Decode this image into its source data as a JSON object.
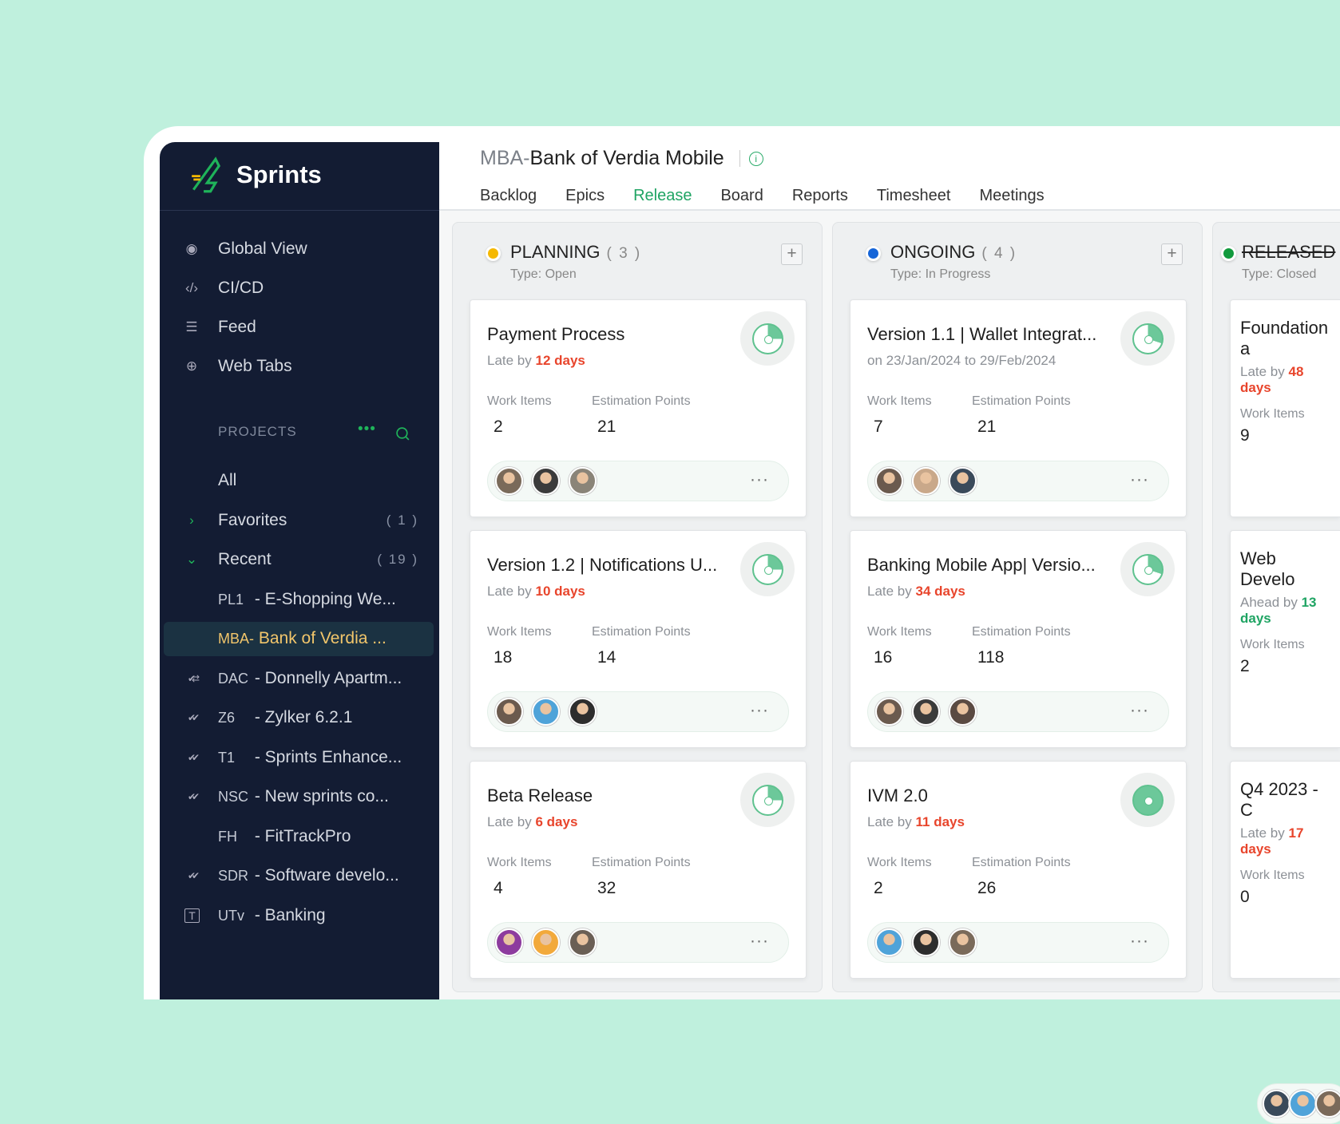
{
  "brand": {
    "name": "Sprints"
  },
  "sidebar": {
    "nav": [
      {
        "label": "Global View",
        "icon": "eye-icon"
      },
      {
        "label": "CI/CD",
        "icon": "code-icon"
      },
      {
        "label": "Feed",
        "icon": "feed-icon"
      },
      {
        "label": "Web Tabs",
        "icon": "globe-icon"
      }
    ],
    "projects_heading": "PROJECTS",
    "all": "All",
    "favorites": {
      "label": "Favorites",
      "count": "( 1 )"
    },
    "recent": {
      "label": "Recent",
      "count": "( 19 )"
    },
    "projects": [
      {
        "code": "PL1",
        "name": "- E-Shopping We...",
        "icon": ""
      },
      {
        "code": "MBA-",
        "name": "Bank of Verdia ...",
        "icon": "",
        "active": true
      },
      {
        "code": "DAC",
        "name": "- Donnelly Apartm...",
        "icon": "check-sync-icon"
      },
      {
        "code": "Z6",
        "name": "- Zylker 6.2.1",
        "icon": "double-check-icon"
      },
      {
        "code": "T1",
        "name": "- Sprints Enhance...",
        "icon": "double-check-icon"
      },
      {
        "code": "NSC",
        "name": "- New sprints co...",
        "icon": "double-check-icon"
      },
      {
        "code": "FH",
        "name": "- FitTrackPro",
        "icon": ""
      },
      {
        "code": "SDR",
        "name": "- Software develo...",
        "icon": "double-check-icon"
      },
      {
        "code": "UTv",
        "name": "- Banking",
        "icon": "template-icon"
      }
    ]
  },
  "header": {
    "prefix": "MBA-",
    "title": "Bank of Verdia Mobile",
    "tabs": [
      "Backlog",
      "Epics",
      "Release",
      "Board",
      "Reports",
      "Timesheet",
      "Meetings"
    ],
    "active_tab": "Release"
  },
  "labels": {
    "work_items": "Work Items",
    "estimation_points": "Estimation Points"
  },
  "colors": {
    "late": "#e8452c",
    "ahead": "#1fa463",
    "accent": "#1fa463"
  },
  "columns": [
    {
      "title": "PLANNING",
      "count": "( 3 )",
      "type": "Type: Open",
      "color": "#f5b800",
      "cards": [
        {
          "title": "Payment Process",
          "sub_prefix": "Late by ",
          "sub_value": "12 days",
          "status": "late",
          "work_items": "2",
          "points": "21",
          "progress": 0.25,
          "avatars": [
            "#7a6a5a",
            "#3b3b3b",
            "#8a8478"
          ]
        },
        {
          "title": "Version 1.2 | Notifications U...",
          "sub_prefix": "Late by ",
          "sub_value": "10 days",
          "status": "late",
          "work_items": "18",
          "points": "14",
          "progress": 0.25,
          "avatars": [
            "#6b5a4e",
            "#4fa3d9",
            "#2d2d2d"
          ]
        },
        {
          "title": "Beta Release",
          "sub_prefix": "Late by ",
          "sub_value": "6 days",
          "status": "late",
          "work_items": "4",
          "points": "32",
          "progress": 0.25,
          "avatars": [
            "#8d3b9e",
            "#f2a93b",
            "#6a5f55"
          ]
        }
      ]
    },
    {
      "title": "ONGOING",
      "count": "( 4 )",
      "type": "Type: In Progress",
      "color": "#1565d8",
      "cards": [
        {
          "title": "Version 1.1 | Wallet Integrat...",
          "sub_prefix": "on 23/Jan/2024 to 29/Feb/2024",
          "sub_value": "",
          "status": "date",
          "work_items": "7",
          "points": "21",
          "progress": 0.3,
          "avatars": [
            "#6b5a4e",
            "#c9a88a",
            "#3a4a5a"
          ]
        },
        {
          "title": "Banking Mobile App| Versio...",
          "sub_prefix": "Late by ",
          "sub_value": "34 days",
          "status": "late",
          "work_items": "16",
          "points": "118",
          "progress": 0.3,
          "avatars": [
            "#6b5a4e",
            "#3b3b3b",
            "#5a4a42"
          ]
        },
        {
          "title": "IVM 2.0",
          "sub_prefix": "Late by ",
          "sub_value": "11 days",
          "status": "late",
          "work_items": "2",
          "points": "26",
          "progress": 1,
          "avatars": [
            "#4fa3d9",
            "#2d2d2d",
            "#7a6a5a"
          ]
        }
      ]
    },
    {
      "title": "RELEASED",
      "count": "",
      "type": "Type: Closed",
      "color": "#119a3d",
      "strike": true,
      "cards": [
        {
          "title": "Foundation a",
          "sub_prefix": "Late by ",
          "sub_value": "48 days",
          "status": "late",
          "work_items": "9",
          "points": "",
          "progress": 0,
          "avatars": [
            "#5a4a42",
            "#f2b33b",
            "#9a9a9a"
          ]
        },
        {
          "title": "Web Develo",
          "sub_prefix": "Ahead by ",
          "sub_value": "13 days",
          "status": "ahead",
          "work_items": "2",
          "points": "",
          "progress": 0,
          "avatars": [
            "#6b5a4e",
            "#6a7a8a",
            "#8a8478"
          ]
        },
        {
          "title": "Q4 2023 - C",
          "sub_prefix": "Late by ",
          "sub_value": "17 days",
          "status": "late",
          "work_items": "0",
          "points": "",
          "progress": 0,
          "avatars": [
            "#3a4a5a",
            "#4fa3d9",
            "#7a6a5a"
          ]
        }
      ]
    }
  ]
}
